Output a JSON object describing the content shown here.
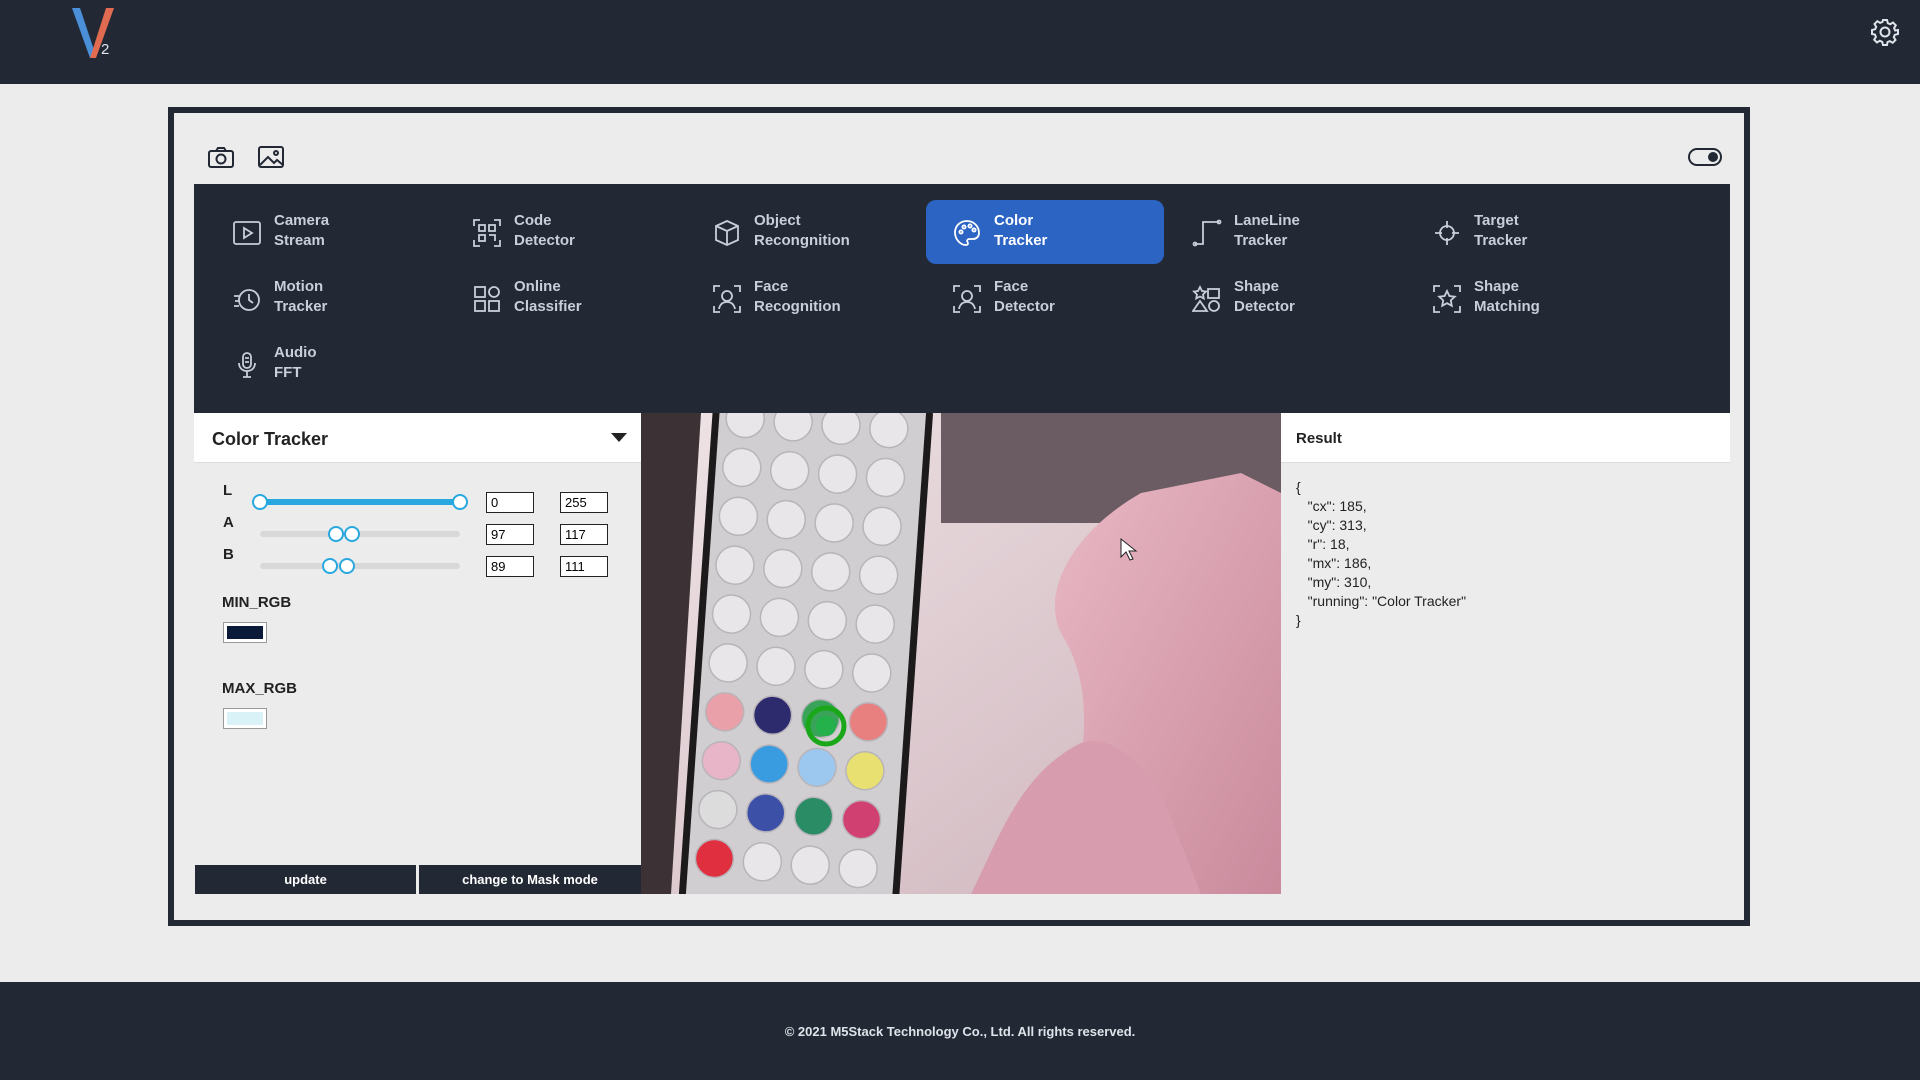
{
  "header": {
    "logo_subscript": "2",
    "brand_colors": {
      "v_left": "#4a8fd8",
      "v_right": "#e06b50",
      "bar": "#222834"
    }
  },
  "toolbar": {
    "icons": [
      "camera-icon",
      "image-icon",
      "toggle-icon",
      "gear-icon"
    ]
  },
  "menu": {
    "accent_color": "#2c64c4",
    "items": [
      {
        "label": "Camera\nStream",
        "icon": "play-square-icon",
        "active": false
      },
      {
        "label": "Code\nDetector",
        "icon": "qr-scan-icon",
        "active": false
      },
      {
        "label": "Object\nRecongnition",
        "icon": "cube-icon",
        "active": false
      },
      {
        "label": "Color\nTracker",
        "icon": "palette-icon",
        "active": true
      },
      {
        "label": "LaneLine\nTracker",
        "icon": "lane-line-icon",
        "active": false
      },
      {
        "label": "Target\nTracker",
        "icon": "crosshair-icon",
        "active": false
      },
      {
        "label": "Motion\nTracker",
        "icon": "motion-icon",
        "active": false
      },
      {
        "label": "Online\nClassifier",
        "icon": "grid-icon",
        "active": false
      },
      {
        "label": "Face\nRecognition",
        "icon": "face-scan-icon",
        "active": false
      },
      {
        "label": "Face\nDetector",
        "icon": "face-detect-icon",
        "active": false
      },
      {
        "label": "Shape\nDetector",
        "icon": "shapes-icon",
        "active": false
      },
      {
        "label": "Shape\nMatching",
        "icon": "star-scan-icon",
        "active": false
      },
      {
        "label": "Audio\nFFT",
        "icon": "microphone-icon",
        "active": false
      }
    ]
  },
  "panel": {
    "title": "Color Tracker",
    "sliders": [
      {
        "label": "L",
        "min_value": "0",
        "max_value": "255",
        "low": 0,
        "high": 255,
        "scale_max": 255
      },
      {
        "label": "A",
        "min_value": "97",
        "max_value": "117",
        "low": 97,
        "high": 117,
        "scale_max": 255
      },
      {
        "label": "B",
        "min_value": "89",
        "max_value": "111",
        "low": 89,
        "high": 111,
        "scale_max": 255
      }
    ],
    "min_rgb_label": "MIN_RGB",
    "max_rgb_label": "MAX_RGB",
    "min_rgb_color": "#0c1a3a",
    "max_rgb_color": "#d8f2f8",
    "update_label": "update",
    "mask_label": "change to Mask mode"
  },
  "result": {
    "title": "Result",
    "lines": [
      "{",
      "   \"cx\": 185,",
      "   \"cy\": 313,",
      "   \"r\": 18,",
      "   \"mx\": 186,",
      "   \"my\": 310,",
      "   \"running\": \"Color Tracker\"",
      "}"
    ]
  },
  "footer": {
    "text": "© 2021 M5Stack Technology Co., Ltd. All rights reserved."
  }
}
